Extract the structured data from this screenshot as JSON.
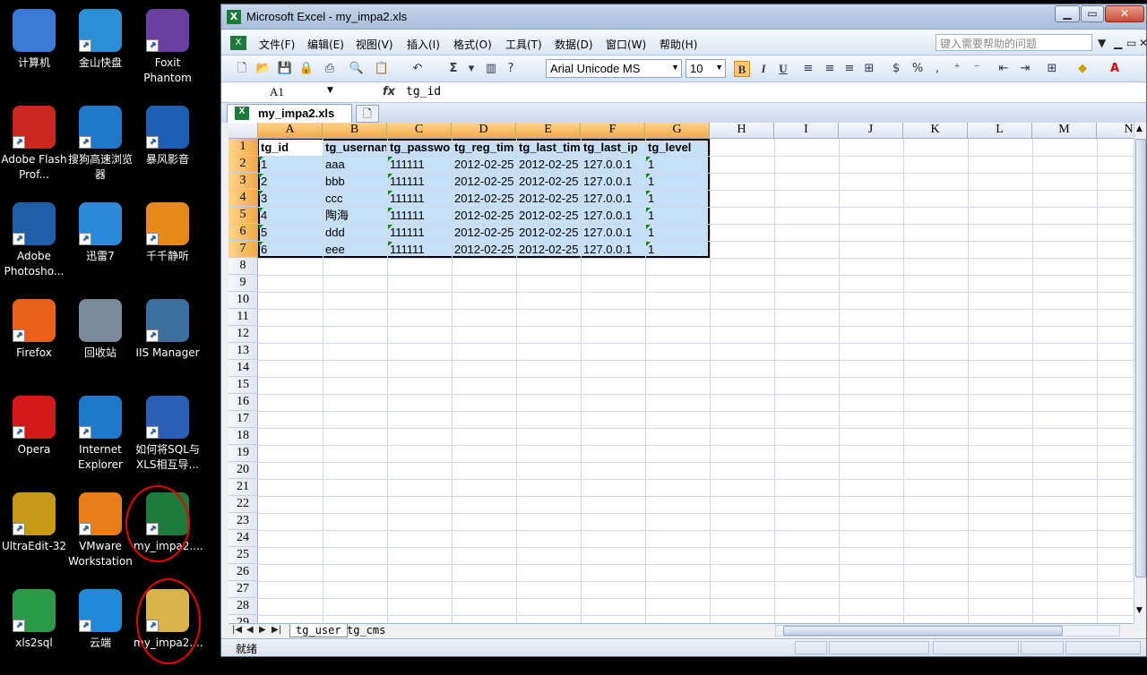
{
  "desktop": {
    "icons": [
      {
        "label": "计算机",
        "icon": "computer-icon",
        "color": "#3a7bd5"
      },
      {
        "label": "金山快盘",
        "icon": "kuaipan-icon",
        "color": "#2c8fd6"
      },
      {
        "label": "Foxit Phantom",
        "icon": "foxit-icon",
        "color": "#6a3fa0"
      },
      {
        "label": "Adobe Flash Prof...",
        "icon": "flash-icon",
        "color": "#c8281e"
      },
      {
        "label": "搜狗高速浏览器",
        "icon": "sogou-browser-icon",
        "color": "#1f78c8"
      },
      {
        "label": "暴风影音",
        "icon": "baofeng-icon",
        "color": "#1e5fb4"
      },
      {
        "label": "Adobe Photosho...",
        "icon": "photoshop-icon",
        "color": "#1e5fa8"
      },
      {
        "label": "迅雷7",
        "icon": "thunder-icon",
        "color": "#2d8ad8"
      },
      {
        "label": "千千静听",
        "icon": "ttplayer-icon",
        "color": "#e88a1a"
      },
      {
        "label": "Firefox",
        "icon": "firefox-icon",
        "color": "#e8621a"
      },
      {
        "label": "回收站",
        "icon": "recycle-bin-icon",
        "color": "#7a8a99"
      },
      {
        "label": "IIS Manager",
        "icon": "iis-icon",
        "color": "#3c6e9e"
      },
      {
        "label": "Opera",
        "icon": "opera-icon",
        "color": "#d21a1a"
      },
      {
        "label": "Internet Explorer",
        "icon": "ie-icon",
        "color": "#1f78c8"
      },
      {
        "label": "如何将SQL与XLS相互导...",
        "icon": "word-doc-icon",
        "color": "#2b5fb5"
      },
      {
        "label": "UltraEdit-32",
        "icon": "ultraedit-icon",
        "color": "#c89a1a"
      },
      {
        "label": "VMware Workstation",
        "icon": "vmware-icon",
        "color": "#e87d1a"
      },
      {
        "label": "my_impa2....",
        "icon": "excel-file-icon",
        "color": "#1d7a3a"
      },
      {
        "label": "xls2sql",
        "icon": "xls2sql-icon",
        "color": "#2a9a4a"
      },
      {
        "label": "云端",
        "icon": "cloud-icon",
        "color": "#1f8ad8"
      },
      {
        "label": "my_impa2....",
        "icon": "folder-icon",
        "color": "#d8b44a"
      }
    ]
  },
  "window": {
    "title": "Microsoft Excel - my_impa2.xls",
    "controls": {
      "minimize": "▁",
      "maximize": "▭",
      "close": "✕"
    }
  },
  "menubar": {
    "items": [
      "文件(F)",
      "编辑(E)",
      "视图(V)",
      "插入(I)",
      "格式(O)",
      "工具(T)",
      "数据(D)",
      "窗口(W)",
      "帮助(H)"
    ],
    "help_placeholder": "键入需要帮助的问题"
  },
  "toolbar": {
    "sum": "Σ",
    "font_name": "Arial Unicode MS",
    "font_size": "10",
    "bold": "B",
    "italic": "I",
    "underline": "U",
    "percent": "%",
    "comma": ","
  },
  "formula_bar": {
    "name_box": "A1",
    "fx": "fx",
    "value": "tg_id"
  },
  "document_tab": {
    "label": "my_impa2.xls"
  },
  "sheet": {
    "columns": [
      "A",
      "B",
      "C",
      "D",
      "E",
      "F",
      "G",
      "H",
      "I",
      "J",
      "K",
      "L",
      "M",
      "N"
    ],
    "row_numbers": [
      "1",
      "2",
      "3",
      "4",
      "5",
      "6",
      "7",
      "8",
      "9",
      "10",
      "11",
      "12",
      "13",
      "14",
      "15",
      "16",
      "17",
      "18",
      "19",
      "20",
      "21",
      "22",
      "23",
      "24",
      "25",
      "26",
      "27",
      "28",
      "29"
    ],
    "headers": [
      "tg_id",
      "tg_usernan",
      "tg_passwor",
      "tg_reg_tim",
      "tg_last_tim",
      "tg_last_ip",
      "tg_level"
    ],
    "rows": [
      [
        "1",
        "aaa",
        "111111",
        "2012-02-25",
        "2012-02-25",
        "127.0.0.1",
        "1"
      ],
      [
        "2",
        "bbb",
        "111111",
        "2012-02-25",
        "2012-02-25",
        "127.0.0.1",
        "1"
      ],
      [
        "3",
        "ccc",
        "111111",
        "2012-02-25",
        "2012-02-25",
        "127.0.0.1",
        "1"
      ],
      [
        "4",
        "陶海",
        "111111",
        "2012-02-25",
        "2012-02-25",
        "127.0.0.1",
        "1"
      ],
      [
        "5",
        "ddd",
        "111111",
        "2012-02-25",
        "2012-02-25",
        "127.0.0.1",
        "1"
      ],
      [
        "6",
        "eee",
        "111111",
        "2012-02-25",
        "2012-02-25",
        "127.0.0.1",
        "1"
      ]
    ],
    "tabs": [
      "tg_user",
      "tg_cms"
    ]
  },
  "status": {
    "text": "就绪"
  }
}
